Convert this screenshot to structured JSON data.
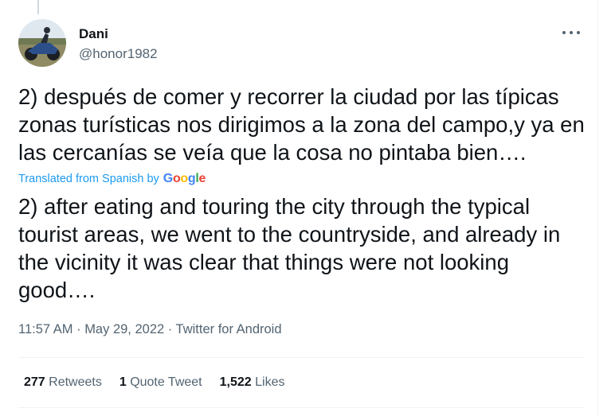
{
  "tweet": {
    "author_name": "Dani",
    "author_handle": "@honor1982",
    "original_text": "2) después de comer y recorrer la ciudad por las típicas zonas turísticas nos dirigimos a la zona del campo,y ya en las cercanías se veía que la cosa no pintaba bien….",
    "translation_note": "Translated from Spanish by",
    "translation_provider": "Google",
    "translated_text": "2) after eating and touring the city through the typical tourist areas, we went to the countryside, and already in the vicinity it was clear that things were not looking good….",
    "time": "11:57 AM",
    "date": "May 29, 2022",
    "separator": "·",
    "source": "Twitter for Android"
  },
  "stats": {
    "retweets_count": "277",
    "retweets_label": "Retweets",
    "quotes_count": "1",
    "quotes_label": "Quote Tweet",
    "likes_count": "1,522",
    "likes_label": "Likes"
  },
  "icons": {
    "more": "more-options-icon",
    "avatar": "avatar-motorcycle"
  },
  "colors": {
    "link_blue": "#1d9bf0",
    "secondary_text": "#536471",
    "primary_text": "#0f1419"
  }
}
